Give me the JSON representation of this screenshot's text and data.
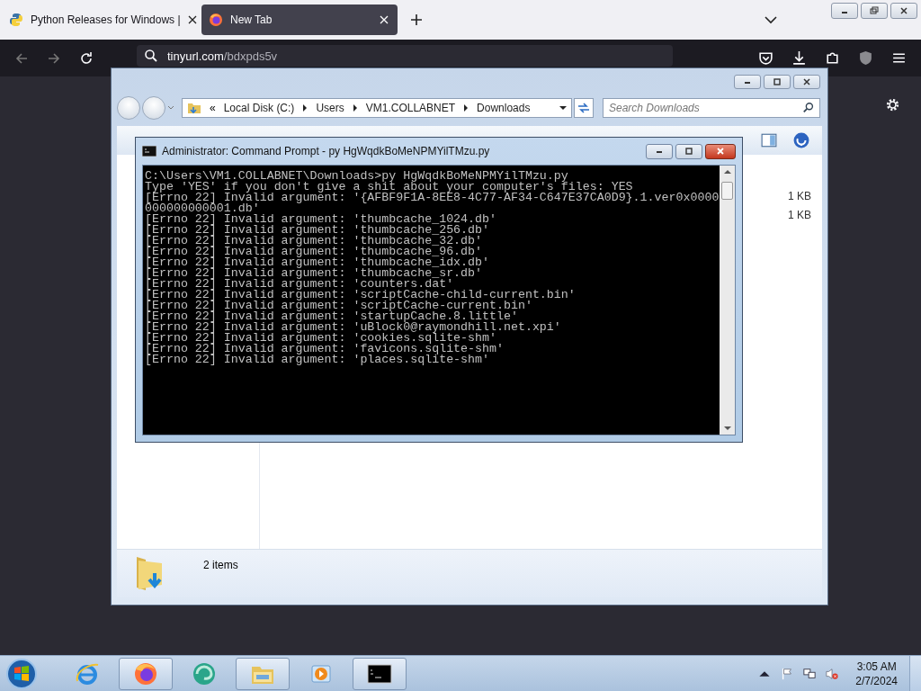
{
  "browser": {
    "tabs": [
      {
        "title": "Python Releases for Windows |",
        "kind": "python",
        "selected": false
      },
      {
        "title": "New Tab",
        "kind": "firefox",
        "selected": true
      }
    ],
    "address": {
      "host": "tinyurl.com",
      "path": "/bdxpds5v"
    }
  },
  "explorer": {
    "overflow": "«",
    "breadcrumb": [
      "Local Disk (C:)",
      "Users",
      "VM1.COLLABNET",
      "Downloads"
    ],
    "search": {
      "placeholder": "Search Downloads"
    },
    "files": [
      {
        "size": "1 KB"
      },
      {
        "size": "1 KB"
      }
    ],
    "status": "2 items"
  },
  "console": {
    "title": "Administrator:  Command Prompt - py  HgWqdkBoMeNPMYilTMzu.py",
    "lines": [
      "C:\\Users\\VM1.COLLABNET\\Downloads>py HgWqdkBoMeNPMYilTMzu.py",
      "Type 'YES' if you don't give a shit about your computer's files: YES",
      "[Errno 22] Invalid argument: '{AFBF9F1A-8EE8-4C77-AF34-C647E37CA0D9}.1.ver0x0000",
      "000000000001.db'",
      "[Errno 22] Invalid argument: 'thumbcache_1024.db'",
      "[Errno 22] Invalid argument: 'thumbcache_256.db'",
      "[Errno 22] Invalid argument: 'thumbcache_32.db'",
      "[Errno 22] Invalid argument: 'thumbcache_96.db'",
      "[Errno 22] Invalid argument: 'thumbcache_idx.db'",
      "[Errno 22] Invalid argument: 'thumbcache_sr.db'",
      "[Errno 22] Invalid argument: 'counters.dat'",
      "[Errno 22] Invalid argument: 'scriptCache-child-current.bin'",
      "[Errno 22] Invalid argument: 'scriptCache-current.bin'",
      "[Errno 22] Invalid argument: 'startupCache.8.little'",
      "[Errno 22] Invalid argument: 'uBlock0@raymondhill.net.xpi'",
      "[Errno 22] Invalid argument: 'cookies.sqlite-shm'",
      "[Errno 22] Invalid argument: 'favicons.sqlite-shm'",
      "[Errno 22] Invalid argument: 'places.sqlite-shm'"
    ]
  },
  "taskbar": {
    "apps": [
      {
        "kind": "ie",
        "running": false
      },
      {
        "kind": "firefox",
        "running": true
      },
      {
        "kind": "globe",
        "running": false
      },
      {
        "kind": "folder",
        "running": true
      },
      {
        "kind": "media",
        "running": false
      },
      {
        "kind": "cmd",
        "running": true
      }
    ],
    "time": "3:05 AM",
    "date": "2/7/2024"
  }
}
